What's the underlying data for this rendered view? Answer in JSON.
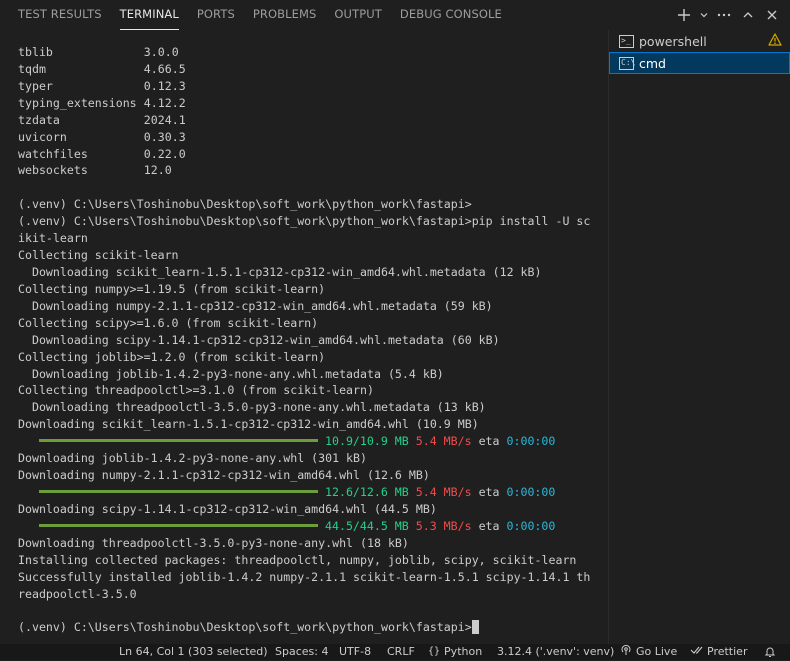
{
  "tabs": [
    {
      "label": "TEST RESULTS",
      "active": false
    },
    {
      "label": "TERMINAL",
      "active": true
    },
    {
      "label": "PORTS",
      "active": false
    },
    {
      "label": "PROBLEMS",
      "active": false
    },
    {
      "label": "OUTPUT",
      "active": false
    },
    {
      "label": "DEBUG CONSOLE",
      "active": false
    }
  ],
  "toolbar_icons": [
    "plus-icon",
    "chevron-down-icon",
    "more-icon",
    "chevron-up-icon",
    "close-icon"
  ],
  "terminals": [
    {
      "name": "powershell",
      "icon": "terminal-powershell-icon",
      "warning": true,
      "selected": false
    },
    {
      "name": "cmd",
      "icon": "terminal-cmd-icon",
      "warning": false,
      "selected": true
    }
  ],
  "packages": [
    {
      "name": "tblib",
      "version": "3.0.0"
    },
    {
      "name": "tqdm",
      "version": "4.66.5"
    },
    {
      "name": "typer",
      "version": "0.12.3"
    },
    {
      "name": "typing_extensions",
      "version": "4.12.2"
    },
    {
      "name": "tzdata",
      "version": "2024.1"
    },
    {
      "name": "uvicorn",
      "version": "0.30.3"
    },
    {
      "name": "watchfiles",
      "version": "0.22.0"
    },
    {
      "name": "websockets",
      "version": "12.0"
    }
  ],
  "output_lines": [
    "",
    "(.venv) C:\\Users\\Toshinobu\\Desktop\\soft_work\\python_work\\fastapi>",
    "(.venv) C:\\Users\\Toshinobu\\Desktop\\soft_work\\python_work\\fastapi>pip install -U sc",
    "ikit-learn",
    "Collecting scikit-learn",
    "  Downloading scikit_learn-1.5.1-cp312-cp312-win_amd64.whl.metadata (12 kB)",
    "Collecting numpy>=1.19.5 (from scikit-learn)",
    "  Downloading numpy-2.1.1-cp312-cp312-win_amd64.whl.metadata (59 kB)",
    "Collecting scipy>=1.6.0 (from scikit-learn)",
    "  Downloading scipy-1.14.1-cp312-cp312-win_amd64.whl.metadata (60 kB)",
    "Collecting joblib>=1.2.0 (from scikit-learn)",
    "  Downloading joblib-1.4.2-py3-none-any.whl.metadata (5.4 kB)",
    "Collecting threadpoolctl>=3.1.0 (from scikit-learn)",
    "  Downloading threadpoolctl-3.5.0-py3-none-any.whl.metadata (13 kB)",
    "Downloading scikit_learn-1.5.1-cp312-cp312-win_amd64.whl (10.9 MB)",
    {
      "progress": {
        "done": "10.9/10.9 MB",
        "speed": "5.4 MB/s",
        "eta_label": "eta",
        "eta": "0:00:00",
        "fraction": 1.0
      }
    },
    "Downloading joblib-1.4.2-py3-none-any.whl (301 kB)",
    "Downloading numpy-2.1.1-cp312-cp312-win_amd64.whl (12.6 MB)",
    {
      "progress": {
        "done": "12.6/12.6 MB",
        "speed": "5.4 MB/s",
        "eta_label": "eta",
        "eta": "0:00:00",
        "fraction": 1.0
      }
    },
    "Downloading scipy-1.14.1-cp312-cp312-win_amd64.whl (44.5 MB)",
    {
      "progress": {
        "done": "44.5/44.5 MB",
        "speed": "5.3 MB/s",
        "eta_label": "eta",
        "eta": "0:00:00",
        "fraction": 1.0
      }
    },
    "Downloading threadpoolctl-3.5.0-py3-none-any.whl (18 kB)",
    "Installing collected packages: threadpoolctl, numpy, joblib, scipy, scikit-learn",
    "Successfully installed joblib-1.4.2 numpy-2.1.1 scikit-learn-1.5.1 scipy-1.14.1 th",
    "readpoolctl-3.5.0",
    "",
    {
      "prompt": "(.venv) C:\\Users\\Toshinobu\\Desktop\\soft_work\\python_work\\fastapi>"
    }
  ],
  "status_bar": {
    "position": "Ln 64, Col 1 (303 selected)",
    "spaces": "Spaces: 4",
    "encoding": "UTF-8",
    "eol": "CRLF",
    "language": "Python",
    "interpreter": "3.12.4 ('.venv': venv)",
    "go_live": "Go Live",
    "prettier": "Prettier"
  },
  "colors": {
    "progress_bar": "#6b9e3a",
    "progress_text": "#23d18b",
    "speed_text": "#f14c4c",
    "eta_text": "#29b8db",
    "warning": "#cca700",
    "selection": "#04395e"
  }
}
